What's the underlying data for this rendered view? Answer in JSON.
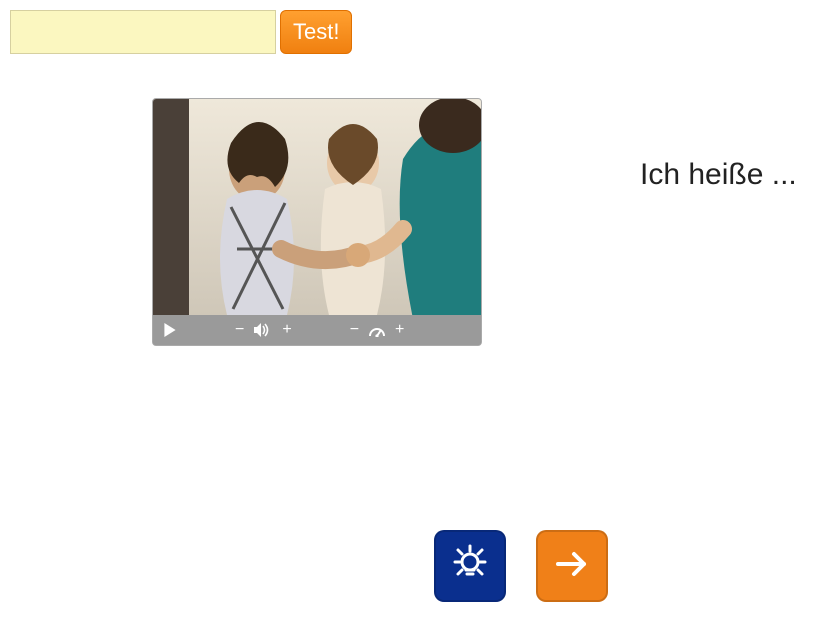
{
  "input": {
    "value": "",
    "placeholder": ""
  },
  "buttons": {
    "test_label": "Test!"
  },
  "prompt_text": "Ich heiße ...",
  "media": {
    "alt": "people-shaking-hands",
    "controls": {
      "play": "play-icon",
      "vol_minus": "−",
      "vol_plus": "+",
      "speed_minus": "−",
      "speed_plus": "+"
    }
  },
  "icons": {
    "hint": "lightbulb-icon",
    "next": "arrow-right-icon",
    "volume": "volume-icon",
    "speed": "gauge-icon"
  }
}
